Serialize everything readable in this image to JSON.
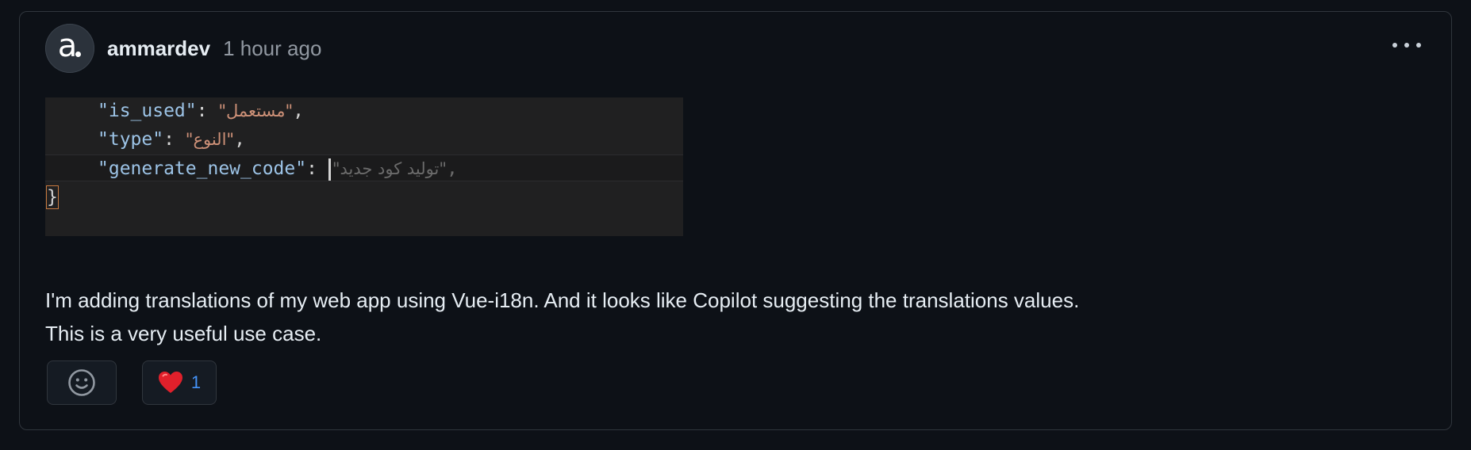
{
  "comment": {
    "author": "ammardev",
    "avatar_letter": "a",
    "timestamp": "1 hour ago",
    "more_icon": "kebab-horizontal-icon"
  },
  "code_screenshot": {
    "lines": [
      {
        "key": "\"is_used\"",
        "sep": ": ",
        "value": "\"مستعمل\"",
        "tail": ","
      },
      {
        "key": "\"type\"",
        "sep": ": ",
        "value": "\"النوع\"",
        "tail": ","
      },
      {
        "key": "\"generate_new_code\"",
        "sep": ": ",
        "value": "\"توليد كود جديد\"",
        "tail": ","
      }
    ],
    "closing": "}"
  },
  "body": {
    "line1": "I'm adding translations of my web app using Vue-i18n. And it looks like Copilot suggesting the translations values.",
    "line2": "This is a very useful use case."
  },
  "reactions": {
    "add_icon": "smiley-icon",
    "heart_icon": "heart-icon",
    "heart_count": "1"
  },
  "colors": {
    "background": "#0d1117",
    "border": "#30363d",
    "count_blue": "#4493f8"
  }
}
